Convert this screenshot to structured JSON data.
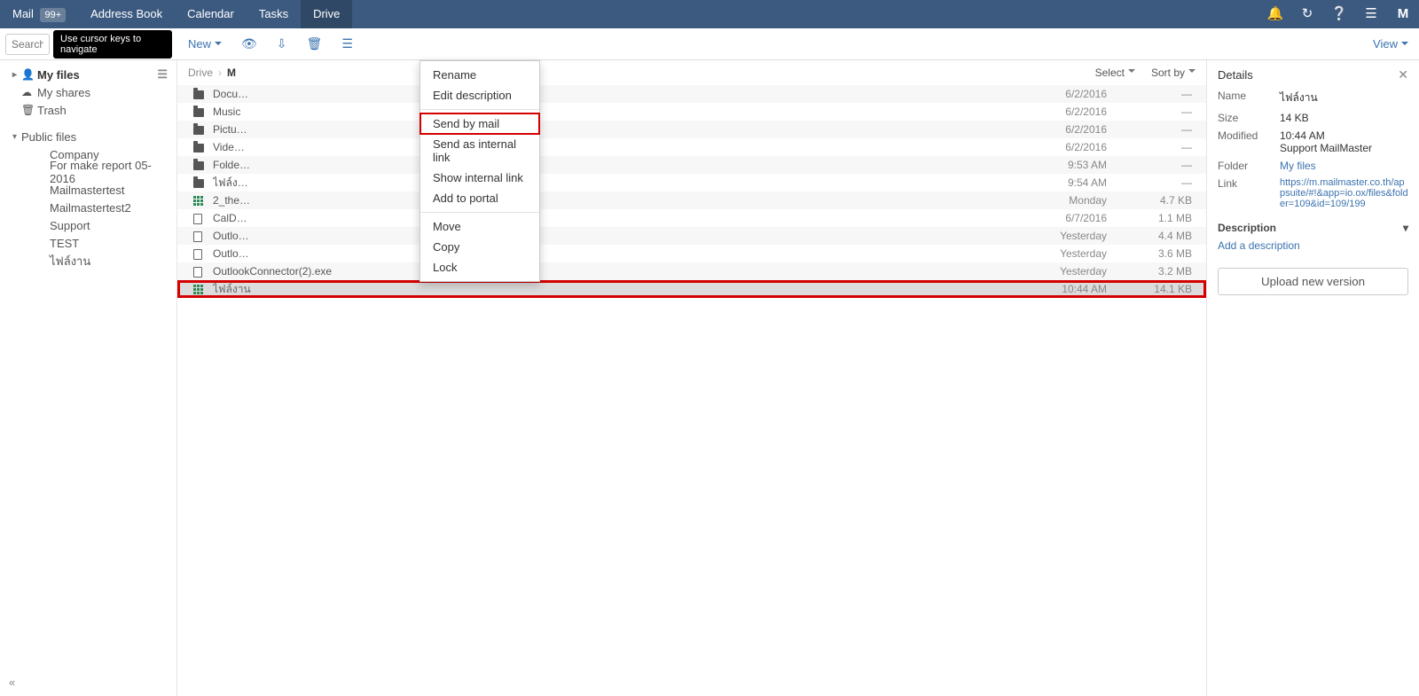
{
  "topnav": {
    "mail_label": "Mail",
    "mail_badge": "99+",
    "address_book": "Address Book",
    "calendar": "Calendar",
    "tasks": "Tasks",
    "drive": "Drive"
  },
  "toolbar": {
    "search_placeholder": "Search...",
    "tooltip": "Use cursor keys to navigate",
    "new_label": "New",
    "view_label": "View"
  },
  "sidebar": {
    "my_files": "My files",
    "my_shares": "My shares",
    "trash": "Trash",
    "public_files": "Public files",
    "public_items": [
      "Company",
      "For make report 05-2016",
      "Mailmastertest",
      "Mailmastertest2",
      "Support",
      "TEST",
      "ไฟล์งาน"
    ]
  },
  "breadcrumb": {
    "root": "Drive",
    "current": "M",
    "select": "Select",
    "sortby": "Sort by"
  },
  "files": [
    {
      "icon": "folder",
      "name": "Docu…",
      "date": "6/2/2016",
      "size": "—"
    },
    {
      "icon": "folder",
      "name": "Music",
      "date": "6/2/2016",
      "size": "—"
    },
    {
      "icon": "folder",
      "name": "Pictu…",
      "date": "6/2/2016",
      "size": "—"
    },
    {
      "icon": "folder",
      "name": "Vide…",
      "date": "6/2/2016",
      "size": "—"
    },
    {
      "icon": "folder",
      "name": "Folde…",
      "date": "9:53 AM",
      "size": "—"
    },
    {
      "icon": "folder",
      "name": "ไฟล์ง…",
      "date": "9:54 AM",
      "size": "—"
    },
    {
      "icon": "grid",
      "name": "2_the…",
      "date": "Monday",
      "size": "4.7 KB"
    },
    {
      "icon": "file",
      "name": "CalD…",
      "date": "6/7/2016",
      "size": "1.1 MB"
    },
    {
      "icon": "file",
      "name": "Outlo…",
      "date": "Yesterday",
      "size": "4.4 MB"
    },
    {
      "icon": "file",
      "name": "Outlo…",
      "date": "Yesterday",
      "size": "3.6 MB"
    },
    {
      "icon": "file",
      "name": "OutlookConnector(2).exe",
      "date": "Yesterday",
      "size": "3.2 MB"
    },
    {
      "icon": "grid",
      "name": "ไฟล์งาน",
      "date": "10:44 AM",
      "size": "14.1 KB"
    }
  ],
  "context_menu": {
    "groups": [
      [
        "Rename",
        "Edit description"
      ],
      [
        "Send by mail",
        "Send as internal link",
        "Show internal link",
        "Add to portal"
      ],
      [
        "Move",
        "Copy",
        "Lock"
      ]
    ],
    "highlight": "Send by mail"
  },
  "details": {
    "header": "Details",
    "name_k": "Name",
    "name_v": "ไฟล์งาน",
    "size_k": "Size",
    "size_v": "14 KB",
    "mod_k": "Modified",
    "mod_v1": "10:44 AM",
    "mod_v2": "Support MailMaster",
    "folder_k": "Folder",
    "folder_v": "My files",
    "link_k": "Link",
    "link_v": "https://m.mailmaster.co.th/appsuite/#!&app=io.ox/files&folder=109&id=109/199",
    "desc_header": "Description",
    "add_desc": "Add a description",
    "upload": "Upload new version"
  }
}
